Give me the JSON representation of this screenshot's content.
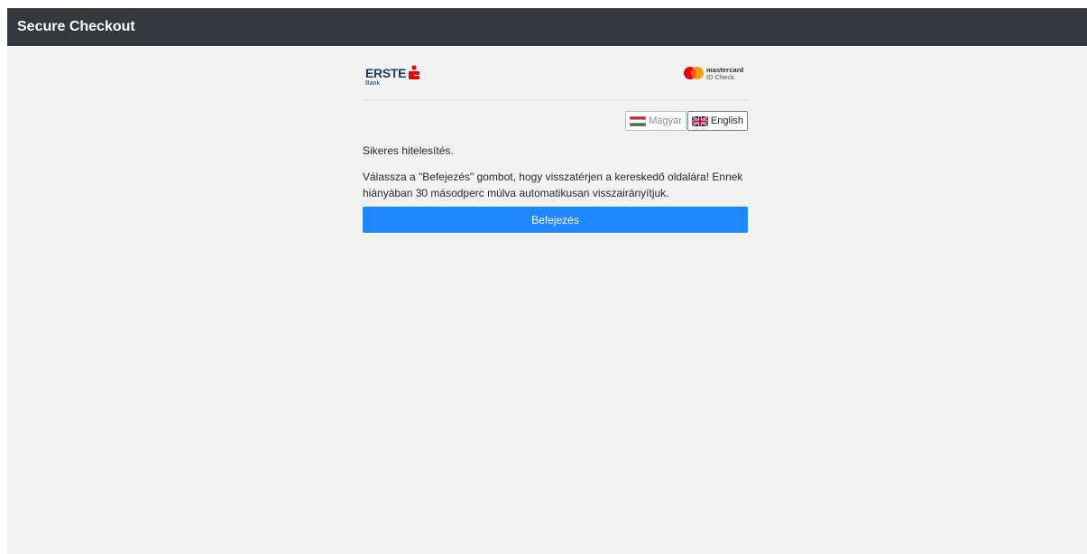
{
  "header": {
    "title": "Secure Checkout"
  },
  "brand": {
    "bank_name": "ERSTE",
    "bank_sub": "Bank",
    "card_brand": "mastercard",
    "card_sub": "ID Check"
  },
  "languages": [
    {
      "label": "Magyar",
      "icon": "hungarian-flag-icon"
    },
    {
      "label": "English",
      "icon": "uk-flag-icon"
    }
  ],
  "message": {
    "status": "Sikeres hitelesítés.",
    "instructions": "Válassza a \"Befejezés\" gombot, hogy visszatérjen a kereskedő oldalára! Ennek hiányában 30 másodperc múlva automatikusan visszairányítjuk."
  },
  "actions": {
    "finish_label": "Befejezés"
  },
  "colors": {
    "topbar": "#35383d",
    "accent": "#1f87ff",
    "erste_red": "#e30613",
    "erste_blue": "#1d3a6f"
  }
}
